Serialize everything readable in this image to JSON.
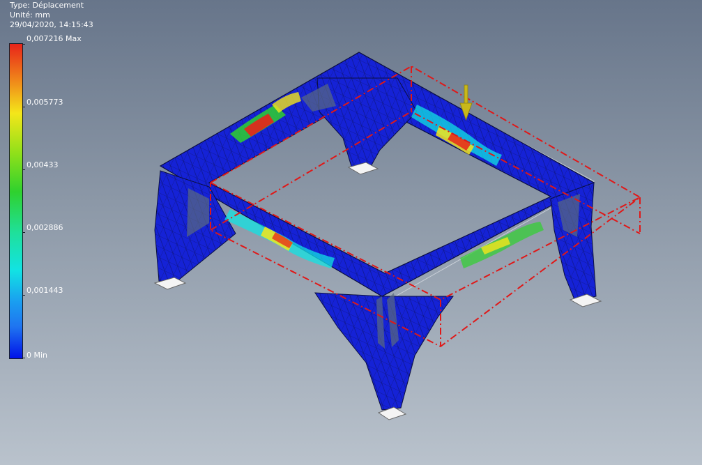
{
  "result_info": {
    "type_line": "Type: Déplacement",
    "unit_line": "Unité: mm",
    "timestamp": "29/04/2020, 14:15:43"
  },
  "color_scale": {
    "labels": [
      "0,007216 Max",
      "0,005773",
      "0,00433",
      "0,002886",
      "0,001443",
      "0 Min"
    ],
    "colors": [
      "#e8241a",
      "#f4e61a",
      "#2fd12e",
      "#12e3e3",
      "#1f74f0",
      "#0012e8"
    ]
  },
  "model": {
    "name": "table-frame-mesh",
    "mesh_color": "#1522d6",
    "bounding_box_color": "#e01818",
    "load_arrow_color": "#c9b81a"
  }
}
